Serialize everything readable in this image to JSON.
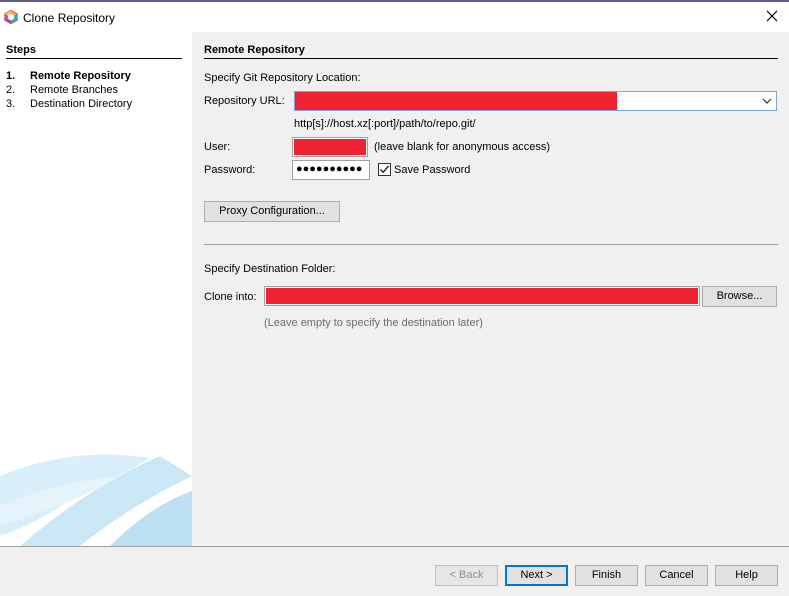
{
  "window": {
    "title": "Clone Repository"
  },
  "steps": {
    "heading": "Steps",
    "items": [
      {
        "num": "1.",
        "label": "Remote Repository",
        "active": true
      },
      {
        "num": "2.",
        "label": "Remote Branches",
        "active": false
      },
      {
        "num": "3.",
        "label": "Destination Directory",
        "active": false
      }
    ]
  },
  "remote": {
    "title": "Remote Repository",
    "location_label": "Specify Git Repository Location:",
    "url_label": "Repository URL:",
    "url_value": "",
    "url_hint": "http[s]://host.xz[:port]/path/to/repo.git/",
    "user_label": "User:",
    "user_value": "",
    "user_hint": "(leave blank for anonymous access)",
    "password_label": "Password:",
    "password_value": "●●●●●●●●●●",
    "save_password_label": "Save Password",
    "save_password_checked": true,
    "proxy_button": "Proxy Configuration..."
  },
  "destination": {
    "folder_label": "Specify Destination Folder:",
    "clone_label": "Clone into:",
    "clone_value": "",
    "browse_button": "Browse...",
    "hint": "(Leave empty to specify the destination later)"
  },
  "buttons": {
    "back": "< Back",
    "next": "Next >",
    "finish": "Finish",
    "cancel": "Cancel",
    "help": "Help"
  },
  "colors": {
    "redacted": "#ee2230",
    "accent": "#0078d7"
  }
}
